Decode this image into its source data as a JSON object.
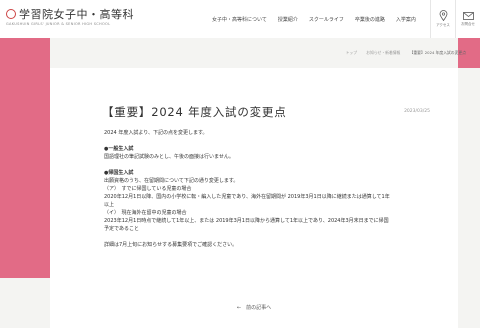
{
  "brand": {
    "title": "学習院女子中・高等科",
    "subtitle": "GAKUSHUIN GIRLS' JUNIOR & SENIOR HIGH SCHOOL",
    "accent": "#e26b86"
  },
  "nav": {
    "items": [
      {
        "label": "女子中・高等科について"
      },
      {
        "label": "授業紹介"
      },
      {
        "label": "スクールライフ"
      },
      {
        "label": "卒業後の進路"
      },
      {
        "label": "入学案内"
      }
    ]
  },
  "utils": [
    {
      "label": "アクセス",
      "icon": "map-pin-icon"
    },
    {
      "label": "お問合せ",
      "icon": "mail-icon"
    }
  ],
  "breadcrumb": {
    "items": [
      "トップ",
      "お知らせ・新着情報",
      "【重要】2024 年度入試の変更点"
    ]
  },
  "article": {
    "title": "【重要】2024 年度入試の変更点",
    "date": "2023/03/25",
    "lines": [
      {
        "text": "2024 年度入試より、下記の点を変更します。",
        "heading": false
      },
      {
        "text": "",
        "heading": false
      },
      {
        "text": "●一般生入試",
        "heading": true
      },
      {
        "text": "国語理社の筆記試験のみとし、午後の面接は行いません。",
        "heading": false
      },
      {
        "text": "",
        "heading": false
      },
      {
        "text": "●帰国生入試",
        "heading": true
      },
      {
        "text": "出願資格のうち、在留期間について下記の通り変更します。",
        "heading": false
      },
      {
        "text": "（ア）　すでに帰国している児童の場合",
        "heading": false
      },
      {
        "text": "2020年12月1日以降、国内の小学校に転・編入した児童であり、海外在留期間が 2019年3月1日以降に継続または通算して1年",
        "heading": false
      },
      {
        "text": "以上",
        "heading": false
      },
      {
        "text": "（イ）　現在海外在留中の児童の場合",
        "heading": false
      },
      {
        "text": "2023年12月1日時点で継続して1年以上、または 2019年3月1日以降から通算して1年以上であり、2024年3月末日までに帰国",
        "heading": false
      },
      {
        "text": "予定であること",
        "heading": false
      },
      {
        "text": "",
        "heading": false
      },
      {
        "text": "詳細は7月上旬にお知らせする募集要項でご確認ください。",
        "heading": false
      }
    ],
    "back_label": "←　前の記事へ"
  }
}
